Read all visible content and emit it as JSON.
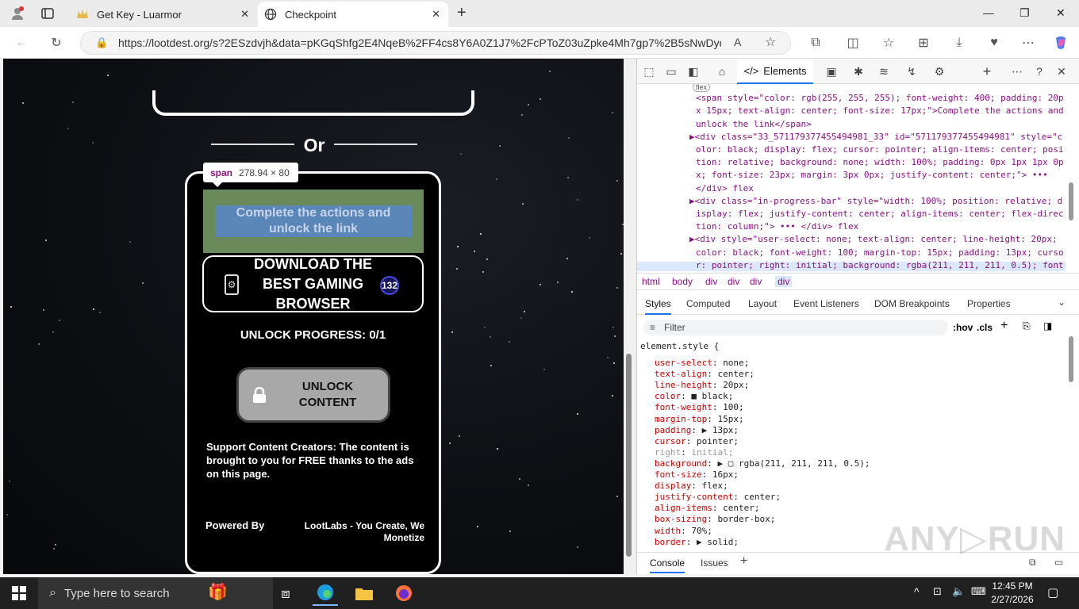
{
  "browser": {
    "tabs": [
      {
        "title": "Get Key - Luarmor",
        "active": false
      },
      {
        "title": "Checkpoint",
        "active": true
      }
    ],
    "url": "https://lootdest.org/s?2ESzdvjh&data=pKGqShfg2E4NqeB%2FF4cs8Y6A0Z1J7%2FcPToZ03uZpke4Mh7gp7%2B5sNwDydr..."
  },
  "page": {
    "or_text": "Or",
    "tooltip": {
      "tag": "span",
      "size": "278.94 × 80"
    },
    "highlight_text": "Complete the actions and unlock the link",
    "download_button": "DOWNLOAD THE BEST GAMING BROWSER",
    "badge_count": "132",
    "progress": "UNLOCK PROGRESS: 0/1",
    "unlock_button": "UNLOCK CONTENT",
    "support_text": "Support Content Creators: The content is brought to you for FREE thanks to the ads on this page.",
    "powered_by": "Powered By",
    "lootlabs": "LootLabs - You Create, We Monetize"
  },
  "devtools": {
    "active_tab": "Elements",
    "dom_lines": [
      {
        "indent": 0,
        "html": "<span class=\"chip\">flex</span>",
        "top": 0
      },
      {
        "indent": 1,
        "text": "<span style=\"color: rgb(255, 255, 255); font-weight: 400; padding: 20p"
      },
      {
        "indent": 1,
        "text": "x 15px; text-align: center; font-size: 17px;\">Complete the actions and"
      },
      {
        "indent": 1,
        "text": "unlock the link</span>"
      },
      {
        "indent": 0,
        "text": "▶<div class=\"33_571179377455494981_33\" id=\"571179377455494981\" style=\"c"
      },
      {
        "indent": 1,
        "text": "olor: black; display: flex; cursor: pointer; align-items: center; posi"
      },
      {
        "indent": 1,
        "text": "tion: relative; background: none; width: 100%; padding: 0px 1px 1px 0p"
      },
      {
        "indent": 1,
        "text": "x; font-size: 23px; margin: 3px 0px; justify-content: center;\"> ••• "
      },
      {
        "indent": 1,
        "text": "</div> flex"
      },
      {
        "indent": 0,
        "text": "▶<div class=\"in-progress-bar\" style=\"width: 100%; position: relative; d"
      },
      {
        "indent": 1,
        "text": "isplay: flex; justify-content: center; align-items: center; flex-direc"
      },
      {
        "indent": 1,
        "text": "tion: column;\"> ••• </div> flex"
      },
      {
        "indent": 0,
        "text": "▶<div style=\"user-select: none; text-align: center; line-height: 20px;"
      },
      {
        "indent": 1,
        "text": "color: black; font-weight: 100; margin-top: 15px; padding: 13px; curso"
      },
      {
        "indent": 1,
        "text": "r: pointer; right: initial; background: rgba(211, 211, 211, 0.5); font"
      }
    ],
    "breadcrumb": [
      "html",
      "body",
      "div",
      "div",
      "div",
      "div"
    ],
    "style_tabs": [
      "Styles",
      "Computed",
      "Layout",
      "Event Listeners",
      "DOM Breakpoints",
      "Properties"
    ],
    "filter_placeholder": "Filter",
    "hov": ":hov",
    "cls": ".cls",
    "css_selector": "element.style {",
    "css_props": [
      {
        "p": "user-select",
        "v": "none;"
      },
      {
        "p": "text-align",
        "v": "center;"
      },
      {
        "p": "line-height",
        "v": "20px;"
      },
      {
        "p": "color",
        "v": "■ black;"
      },
      {
        "p": "font-weight",
        "v": "100;"
      },
      {
        "p": "margin-top",
        "v": "15px;"
      },
      {
        "p": "padding",
        "v": "▶ 13px;"
      },
      {
        "p": "cursor",
        "v": "pointer;"
      },
      {
        "p": "right",
        "v": "initial;",
        "dim": true
      },
      {
        "p": "background",
        "v": "▶ ▢ rgba(211, 211, 211, 0.5);"
      },
      {
        "p": "font-size",
        "v": "16px;"
      },
      {
        "p": "display",
        "v": "flex;"
      },
      {
        "p": "justify-content",
        "v": "center;"
      },
      {
        "p": "align-items",
        "v": "center;"
      },
      {
        "p": "box-sizing",
        "v": "border-box;"
      },
      {
        "p": "width",
        "v": "70%;"
      },
      {
        "p": "border",
        "v": "▶ solid;"
      }
    ],
    "drawer_tabs": [
      "Console",
      "Issues"
    ]
  },
  "taskbar": {
    "search_placeholder": "Type here to search",
    "time": "12:45 PM",
    "date": "2/27/2026"
  }
}
